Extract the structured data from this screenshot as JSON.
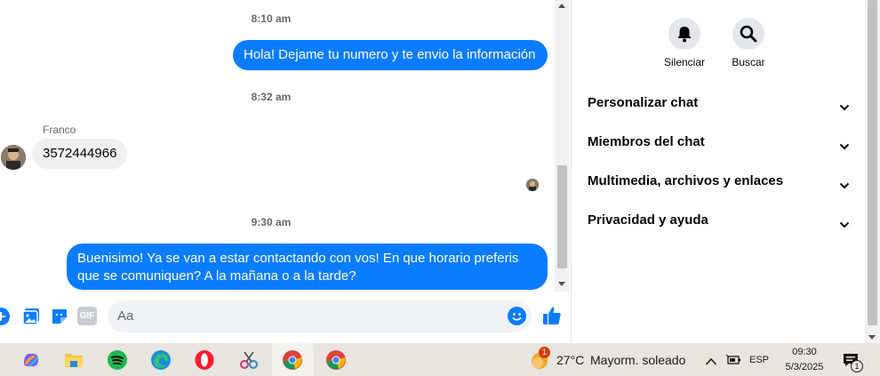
{
  "chat": {
    "timestamps": [
      "8:10 am",
      "8:32 am",
      "9:30 am"
    ],
    "messages": {
      "out1": "Hola! Dejame tu numero y te envio la información",
      "in1_sender": "Franco",
      "in1": "3572444966",
      "out2": "Buenisimo! Ya se van a estar contactando con vos! En que horario preferis que se comuniquen? A la mañana o a la tarde?"
    }
  },
  "composer": {
    "placeholder": "Aa",
    "gif_label": "GIF"
  },
  "details": {
    "actions": [
      {
        "label": "Silenciar",
        "icon": "bell-icon"
      },
      {
        "label": "Buscar",
        "icon": "search-icon"
      }
    ],
    "sections": [
      "Personalizar chat",
      "Miembros del chat",
      "Multimedia, archivos y enlaces",
      "Privacidad y ayuda"
    ]
  },
  "taskbar": {
    "weather_badge": "1",
    "temperature": "27°C",
    "weather": "Mayorm. soleado",
    "language": "ESP",
    "time": "09:30",
    "date": "5/3/2025",
    "notification_count": "1"
  },
  "colors": {
    "accent": "#0a7cff",
    "incoming_bubble": "#f0f0f0",
    "taskbar": "#e8e4df"
  }
}
